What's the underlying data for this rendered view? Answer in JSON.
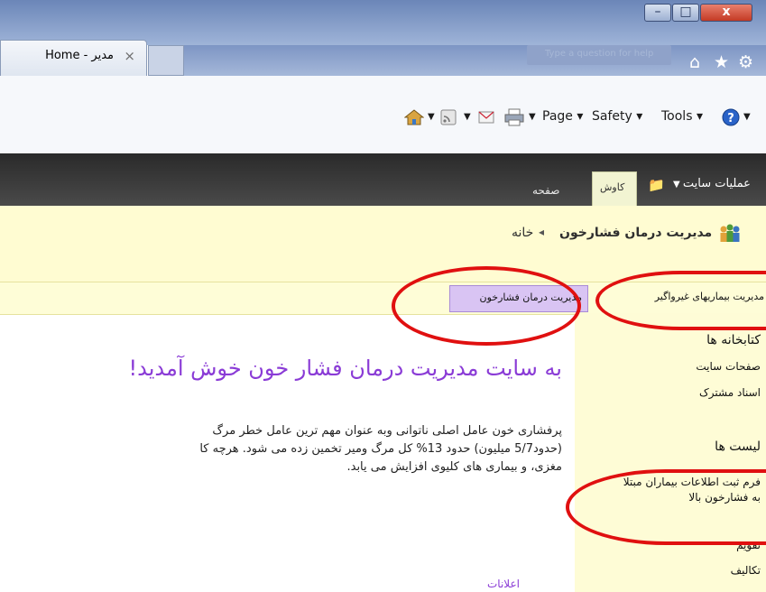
{
  "browser": {
    "tab_title": "Home - مدیر",
    "tab_close": "×",
    "search_placeholder": "Type a question for help"
  },
  "window_controls": {
    "minimize": "–",
    "maximize": "□",
    "close": "x"
  },
  "toolbar_icons": {
    "home": "⌂",
    "favorites": "★",
    "settings": "⚙"
  },
  "command_bar": {
    "page_label": "Page",
    "safety_label": "Safety",
    "tools_label": "Tools",
    "dropdown_arrow": "▾"
  },
  "ribbon": {
    "site_actions": "عملیات سایت",
    "browse_tab": "کاوش",
    "page_tab": "صفحه"
  },
  "breadcrumb": {
    "site": "مدیریت درمان فشارخون",
    "separator": "◂",
    "current": "خانه"
  },
  "topnav": {
    "items": [
      "مدیریت بیماریهای غیرواگیر",
      "مدیریت درمان فشارخون"
    ]
  },
  "quick_launch": {
    "libraries_heading": "کتابخانه ها",
    "site_pages": "صفحات سایت",
    "shared_documents": "اسناد مشترک",
    "lists_heading": "لیست ها",
    "form_line1": "فرم ثبت اطلاعات بیماران مبتلا",
    "form_line2": "به فشارخون بالا",
    "calendar": "تقویم",
    "tasks": "تکالیف"
  },
  "main": {
    "welcome": "به سایت مدیریت درمان فشار خون خوش آمدید!",
    "para_line1": "پرفشاری خون عامل اصلی ناتوانی وبه عنوان مهم ترین عامل خطر مرگ",
    "para_line2": "(حدود5/7 میلیون) حدود 13% کل مرگ ومیر تخمین زده می شود. هرچه کا",
    "para_line3": "مغزی، و بیماری های کلیوی افزایش می یابد.",
    "announcements": "اعلانات"
  }
}
